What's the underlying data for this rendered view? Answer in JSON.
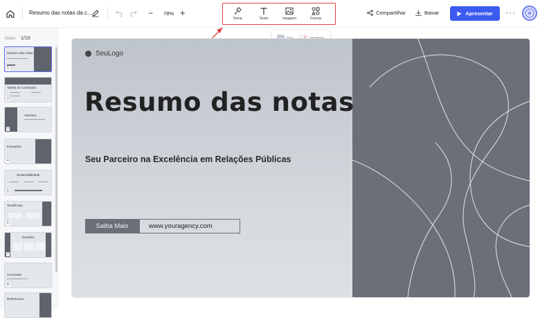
{
  "topbar": {
    "doc_title": "Resumo das notas da c...",
    "zoom": "78%",
    "zoom_out": "−",
    "zoom_in": "+",
    "tools": [
      {
        "label": "Tema",
        "icon": "theme-icon"
      },
      {
        "label": "Texto",
        "icon": "text-icon"
      },
      {
        "label": "Imagem",
        "icon": "image-icon"
      },
      {
        "label": "Forma",
        "icon": "shape-icon"
      }
    ],
    "share_label": "Compartilhar",
    "download_label": "Baixar",
    "present_label": "Apresentar",
    "more": "···"
  },
  "popup": {
    "color_label": "Cor",
    "image_label": "Imagem"
  },
  "sidebar": {
    "slides_label": "Slides",
    "count": "1/10",
    "thumbnails": [
      {
        "number": "1",
        "title": "Resumo das notas"
      },
      {
        "number": "2",
        "title": "Tabela de Conteúdos"
      },
      {
        "number": "3",
        "title": "Abertura"
      },
      {
        "number": "4",
        "title": "Inovações"
      },
      {
        "number": "5",
        "title": "Sustentabilidade"
      },
      {
        "number": "6",
        "title": "Tendências"
      },
      {
        "number": "7",
        "title": "Desafios"
      },
      {
        "number": "8",
        "title": "Conclusão"
      },
      {
        "number": "9",
        "title": "Referências"
      }
    ]
  },
  "slide": {
    "logo": "SeuLogo",
    "headline": "Resumo das notas",
    "subline": "Seu Parceiro na Excelência em Relações Públicas",
    "cta_label": "Saiba Mais",
    "cta_url": "www.youragency.com"
  },
  "colors": {
    "accent": "#3b5af0",
    "annotation": "#e14040",
    "slide_dark": "#6a6f78"
  }
}
